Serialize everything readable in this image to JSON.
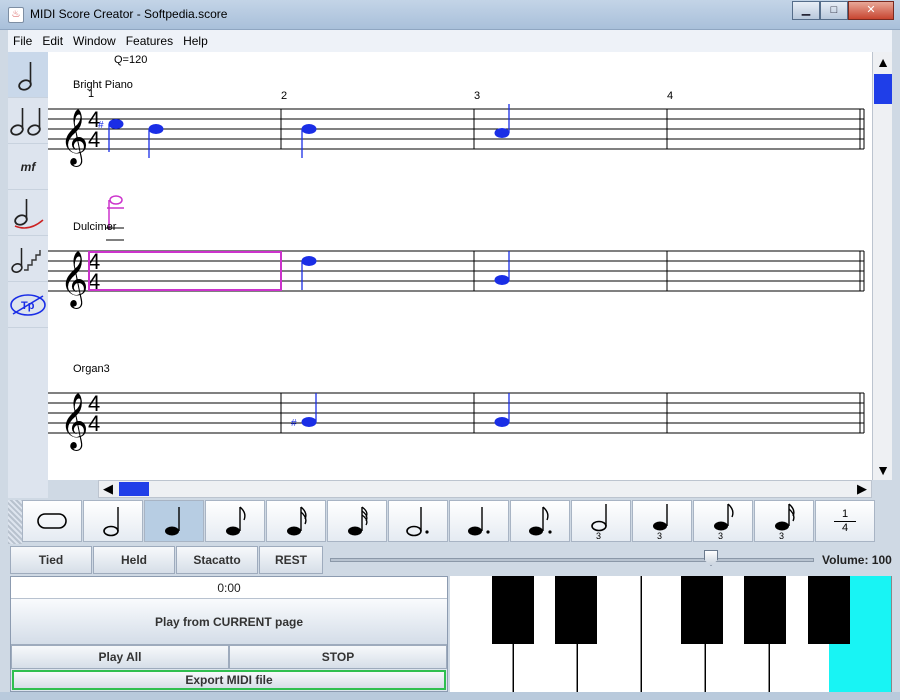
{
  "window": {
    "title": "MIDI Score Creator - Softpedia.score",
    "minimize": "▁",
    "maximize": "□",
    "close": "✕"
  },
  "menu": [
    "File",
    "Edit",
    "Window",
    "Features",
    "Help"
  ],
  "left_tools": [
    {
      "icon": "quarter-note-icon",
      "glyph": "𝅗𝅥",
      "active": true
    },
    {
      "icon": "two-notes-icon",
      "glyph": "𝅗𝅥𝅗𝅥"
    },
    {
      "icon": "dynamics-icon",
      "glyph": "mf"
    },
    {
      "icon": "slur-note-icon",
      "glyph": "𝅗𝅥"
    },
    {
      "icon": "staircase-note-icon",
      "glyph": "𝅗𝅥"
    },
    {
      "icon": "no-tuplet-icon",
      "glyph": "Tp"
    }
  ],
  "score": {
    "tempo": "Q=120",
    "measures": [
      "1",
      "2",
      "3",
      "4"
    ],
    "staves": [
      {
        "instrument": "Bright Piano",
        "time_signature": [
          "4",
          "4"
        ]
      },
      {
        "instrument": "Dulcimer",
        "time_signature": [
          "4",
          "4"
        ]
      },
      {
        "instrument": "Organ3",
        "time_signature": [
          "4",
          "4"
        ]
      }
    ]
  },
  "palette": [
    {
      "icon": "whole-note-icon",
      "glyph": "𝅝"
    },
    {
      "icon": "half-note-icon",
      "glyph": "𝅗𝅥"
    },
    {
      "icon": "quarter-note-icon",
      "glyph": "♩",
      "selected": true
    },
    {
      "icon": "eighth-note-icon",
      "glyph": "♪"
    },
    {
      "icon": "sixteenth-note-icon",
      "glyph": "𝅘𝅥𝅯"
    },
    {
      "icon": "thirty-second-note-icon",
      "glyph": "𝅘𝅥𝅰"
    },
    {
      "icon": "dotted-half-note-icon",
      "glyph": "𝅗𝅥."
    },
    {
      "icon": "dotted-quarter-note-icon",
      "glyph": "♩."
    },
    {
      "icon": "dotted-eighth-note-icon",
      "glyph": "♪."
    },
    {
      "icon": "triplet-half-note-icon",
      "glyph": "𝅗𝅥"
    },
    {
      "icon": "triplet-quarter-note-icon",
      "glyph": "♩"
    },
    {
      "icon": "triplet-eighth-note-icon",
      "glyph": "♪"
    },
    {
      "icon": "triplet-sixteenth-note-icon",
      "glyph": "𝅘𝅥𝅯"
    }
  ],
  "fraction": {
    "numerator": "1",
    "denominator": "4"
  },
  "articulation": {
    "tied": "Tied",
    "held": "Held",
    "staccato": "Stacatto",
    "rest": "REST"
  },
  "volume": {
    "label": "Volume: 100",
    "value": 100
  },
  "playback": {
    "time": "0:00",
    "play_current": "Play from CURRENT page",
    "play_all": "Play All",
    "stop": "STOP",
    "export": "Export MIDI file"
  },
  "colors": {
    "note": "#1a2ee6",
    "selection": "#cc33cc",
    "highlight_key": "#18f4f4",
    "scroll_thumb": "#1f3ee8"
  }
}
